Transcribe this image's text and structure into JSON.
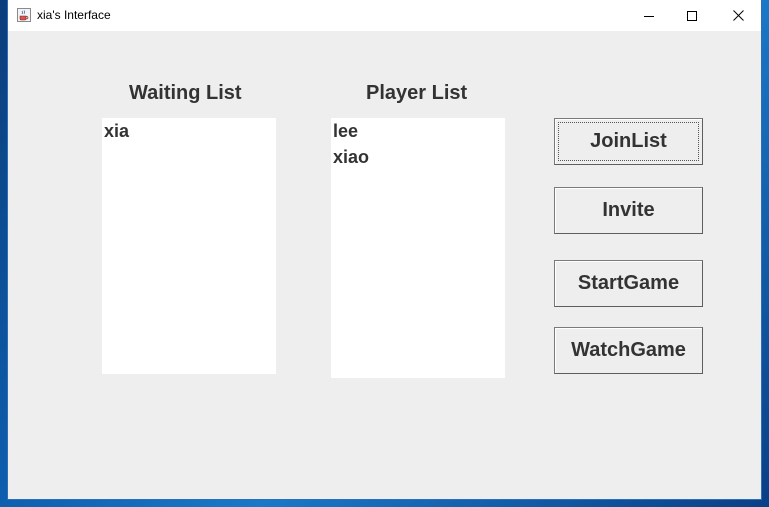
{
  "window": {
    "title": "xia's Interface"
  },
  "waiting": {
    "heading": "Waiting List",
    "items": [
      "xia"
    ]
  },
  "player": {
    "heading": "Player List",
    "items": [
      "lee",
      "xiao"
    ]
  },
  "buttons": {
    "join": "JoinList",
    "invite": "Invite",
    "start": "StartGame",
    "watch": "WatchGame"
  },
  "icons": {
    "app": "java-coffee-cup-icon",
    "minimize": "minimize-icon",
    "maximize": "maximize-icon",
    "close": "close-icon"
  }
}
